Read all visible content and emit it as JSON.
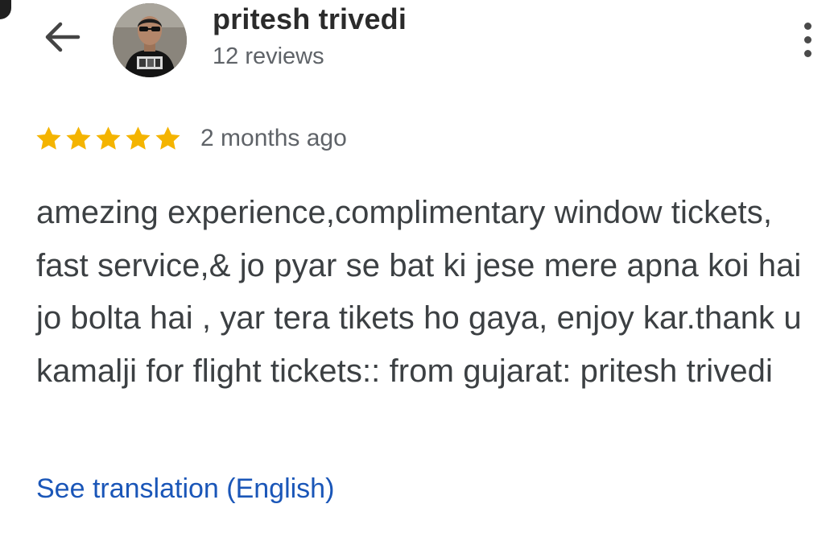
{
  "header": {
    "back_icon": "arrow-back-icon",
    "more_icon": "more-vertical-icon",
    "user_name": "pritesh trivedi",
    "review_count": "12 reviews"
  },
  "review": {
    "rating": 5,
    "rating_max": 5,
    "star_color": "#f4b400",
    "time_ago": "2 months ago",
    "text": "amezing experience,complimentary window tickets, fast service,& jo pyar se bat ki jese mere apna koi hai jo bolta hai , yar tera tikets ho gaya, enjoy kar.thank u kamalji for flight tickets:: from gujarat: pritesh trivedi",
    "translate_label": "See translation (English)"
  },
  "colors": {
    "link": "#1a56b8",
    "body_text": "#3c4043",
    "secondary_text": "#5f6368"
  }
}
